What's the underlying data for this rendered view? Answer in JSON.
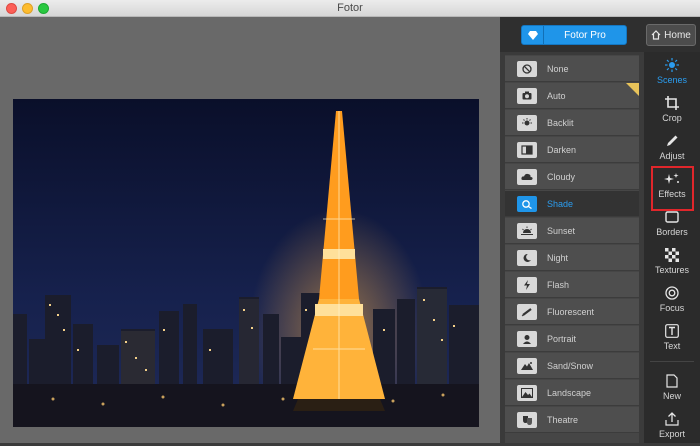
{
  "window": {
    "title": "Fotor"
  },
  "header": {
    "pro_button_label": "Fotor Pro",
    "home_button_label": "Home"
  },
  "scenes": [
    {
      "label": "None",
      "icon": "none-icon",
      "pro": false
    },
    {
      "label": "Auto",
      "icon": "camera-icon",
      "pro": true
    },
    {
      "label": "Backlit",
      "icon": "backlit-icon",
      "pro": false
    },
    {
      "label": "Darken",
      "icon": "darken-icon",
      "pro": false
    },
    {
      "label": "Cloudy",
      "icon": "cloud-icon",
      "pro": false
    },
    {
      "label": "Shade",
      "icon": "shade-icon",
      "pro": false,
      "active": true
    },
    {
      "label": "Sunset",
      "icon": "sunset-icon",
      "pro": false
    },
    {
      "label": "Night",
      "icon": "moon-icon",
      "pro": false
    },
    {
      "label": "Flash",
      "icon": "flash-icon",
      "pro": false
    },
    {
      "label": "Fluorescent",
      "icon": "fluorescent-icon",
      "pro": false
    },
    {
      "label": "Portrait",
      "icon": "portrait-icon",
      "pro": false
    },
    {
      "label": "Sand/Snow",
      "icon": "sand-snow-icon",
      "pro": false
    },
    {
      "label": "Landscape",
      "icon": "landscape-icon",
      "pro": false
    },
    {
      "label": "Theatre",
      "icon": "theatre-icon",
      "pro": false
    }
  ],
  "tools": [
    {
      "label": "Scenes",
      "icon": "sun-icon",
      "active": true
    },
    {
      "label": "Crop",
      "icon": "crop-icon"
    },
    {
      "label": "Adjust",
      "icon": "pencil-icon"
    },
    {
      "label": "Effects",
      "icon": "sparkle-icon",
      "highlighted": true
    },
    {
      "label": "Borders",
      "icon": "border-icon"
    },
    {
      "label": "Textures",
      "icon": "texture-icon"
    },
    {
      "label": "Focus",
      "icon": "focus-icon"
    },
    {
      "label": "Text",
      "icon": "text-icon"
    },
    {
      "label": "New",
      "icon": "new-icon"
    },
    {
      "label": "Export",
      "icon": "export-icon"
    }
  ],
  "colors": {
    "accent": "#1f95e9",
    "highlight_box": "#e0262b"
  }
}
